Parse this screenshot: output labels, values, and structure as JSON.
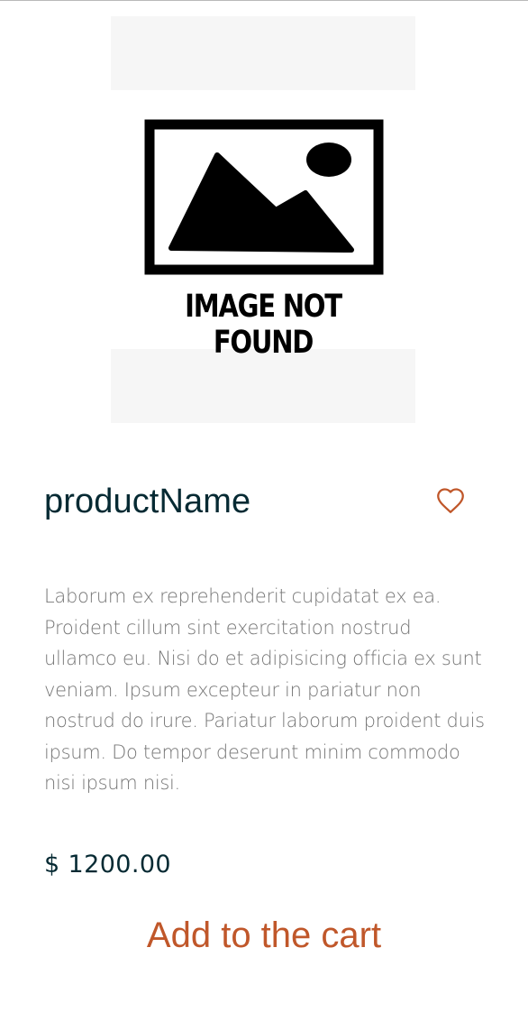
{
  "product": {
    "image": {
      "icon": "image-not-found-icon",
      "placeholder_text": "IMAGE NOT FOUND"
    },
    "name": "productName",
    "favorite_icon": "heart-outline-icon",
    "description": "Laborum ex reprehenderit cupidatat ex ea. Proident cillum sint exercitation nostrud ullamco eu. Nisi do et adipisicing officia ex sunt veniam. Ipsum excepteur in pariatur non nostrud do irure. Pariatur laborum proident duis ipsum. Do tempor deserunt minim commodo nisi ipsum nisi.",
    "price": "$ 1200.00",
    "add_to_cart_label": "Add to the cart"
  },
  "colors": {
    "title": "#062a33",
    "accent": "#c0572a",
    "description": "#767676",
    "image_placeholder_bg": "#f6f6f6"
  }
}
